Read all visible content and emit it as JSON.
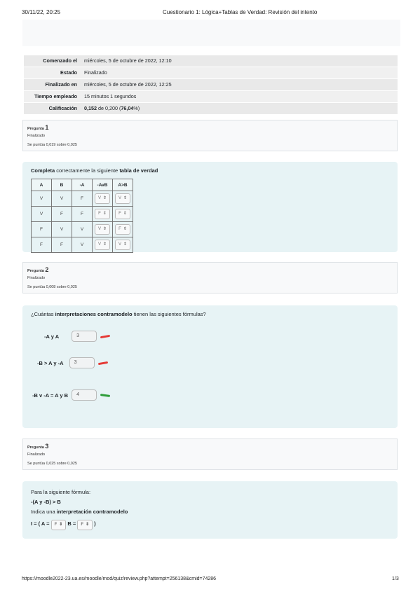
{
  "header": {
    "datetime": "30/11/22, 20:25",
    "title": "Cuestionario 1: Lógica+Tablas de Verdad: Revisión del intento"
  },
  "summary": [
    {
      "label": "Comenzado el",
      "value": "miércoles, 5 de octubre de 2022, 12:10"
    },
    {
      "label": "Estado",
      "value": "Finalizado"
    },
    {
      "label": "Finalizado en",
      "value": "miércoles, 5 de octubre de 2022, 12:25"
    },
    {
      "label": "Tiempo empleado",
      "value": "15 minutos 1 segundos"
    },
    {
      "label": "Calificación",
      "value_bold": "0,152",
      "value_mid": " de 0,200 (",
      "value_pct": "76,04",
      "value_end": "%)"
    }
  ],
  "q1": {
    "label": "Pregunta",
    "number": "1",
    "state": "Finalizado",
    "grade": "Se puntúa 0,019 sobre 0,025",
    "prompt_a": "Completa",
    "prompt_b": " correctamente la siguiente ",
    "prompt_c": "tabla de verdad",
    "headers": [
      "A",
      "B",
      "-A",
      "-AvB",
      "A>B"
    ],
    "rows": [
      [
        "V",
        "V",
        "F",
        "V",
        "V"
      ],
      [
        "V",
        "F",
        "F",
        "F",
        "F"
      ],
      [
        "F",
        "V",
        "V",
        "V",
        "F"
      ],
      [
        "F",
        "F",
        "V",
        "V",
        "V"
      ]
    ]
  },
  "q2": {
    "label": "Pregunta",
    "number": "2",
    "state": "Finalizado",
    "grade": "Se puntúa 0,008 sobre 0,025",
    "prompt_a": "¿Cuántas ",
    "prompt_b": "interpretaciones contramodelo",
    "prompt_c": " tienen las siguientes fórmulas?",
    "items": [
      {
        "formula": "-A y A",
        "answer": "3",
        "mark_color": "#e53935"
      },
      {
        "formula": "-B > A y -A",
        "answer": "3",
        "mark_color": "#e53935"
      },
      {
        "formula": "-B v -A = A y B",
        "answer": "4",
        "mark_color": "#2e9d3a"
      }
    ]
  },
  "q3": {
    "label": "Pregunta",
    "number": "3",
    "state": "Finalizado",
    "grade": "Se puntúa 0,025 sobre 0,025",
    "line1": "Para la siguiente fórmula:",
    "formula": "-(A y -B) > B",
    "line3_a": "Indica una ",
    "line3_b": "interpretación contramodelo",
    "interp_prefix": "I = ( A = ",
    "a_value": "F",
    "interp_mid": " B = ",
    "b_value": "F",
    "interp_end": " )"
  },
  "footer": {
    "url": "https://moodle2022-23.ua.es/moodle/mod/quiz/review.php?attempt=256138&cmid=74286",
    "page": "1/3"
  }
}
